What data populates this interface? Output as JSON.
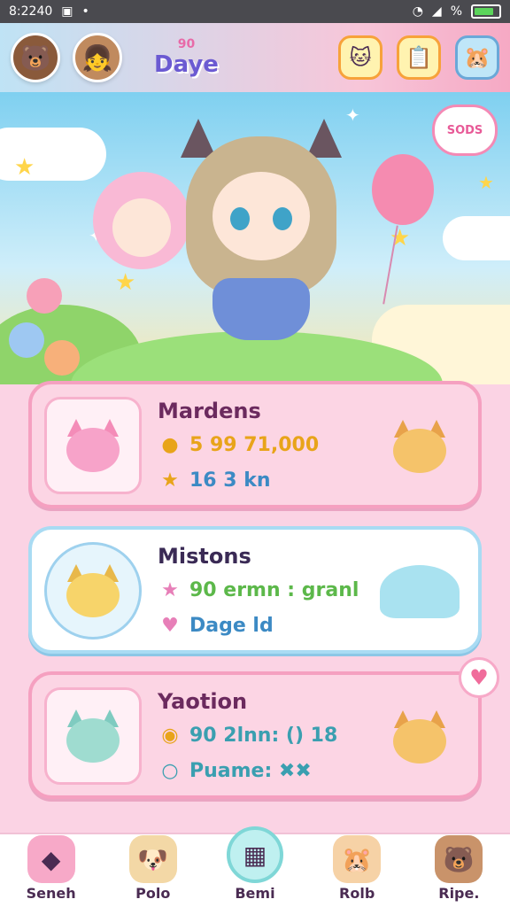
{
  "status_bar": {
    "time": "8:2240",
    "battery_label": "%"
  },
  "header": {
    "title_small": "90",
    "title": "Daye"
  },
  "scene": {
    "sign_text": "SODS"
  },
  "cards": [
    {
      "name": "Mardens",
      "row1_value": "5 99 71,000",
      "row2_value": "16 3 kn"
    },
    {
      "name": "Mistons",
      "row1_value": "90 ermn : granl",
      "row2_value": "Dage ld"
    },
    {
      "name": "Yaotion",
      "row1_value": "90 2lnn: () 18",
      "row2_value": "Puame: ✖✖"
    }
  ],
  "bottom_nav": [
    {
      "label": "Seneh"
    },
    {
      "label": "Polo"
    },
    {
      "label": "Bemi"
    },
    {
      "label": "Rolb"
    },
    {
      "label": "Ripe."
    }
  ],
  "colors": {
    "pink": "#f5a0c0",
    "blue": "#a9dbf3",
    "title": "#6b5ad2"
  }
}
